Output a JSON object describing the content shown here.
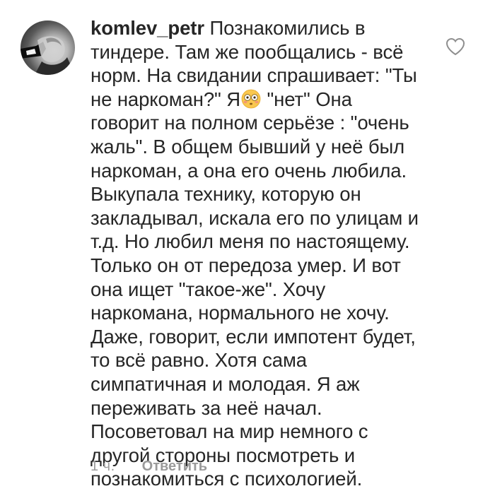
{
  "comment": {
    "username": "komlev_petr",
    "text_part1": "Познакомились в тиндере. Там же пообщались - всё норм. На свидании спрашивает: \"Ты не наркоман?\" Я",
    "emoji": "flushed-face-emoji",
    "text_part2": " \"нет\" Она говорит на полном серьёзе : \"очень жаль\". В общем бывший у неё был наркоман, а она его очень любила. Выкупала технику, которую он закладывал, искала его по улицам и т.д. Но любил меня по настоящему. Только он от передоза умер. И вот она ищет \"такое-же\". Хочу наркомана, нормального не хочу. Даже, говорит, если импотент будет, то всё равно. Хотя сама симпатичная и молодая. Я аж переживать за неё начал. Посоветовал на мир немного с другой стороны посмотреть и познакомиться с психологией.",
    "time": "1 ч.",
    "reply_label": "Ответить",
    "like_icon": "heart-outline-icon",
    "avatar_icon": "user-avatar"
  },
  "colors": {
    "text": "#262626",
    "meta": "#9a9a9a",
    "background": "#ffffff"
  }
}
